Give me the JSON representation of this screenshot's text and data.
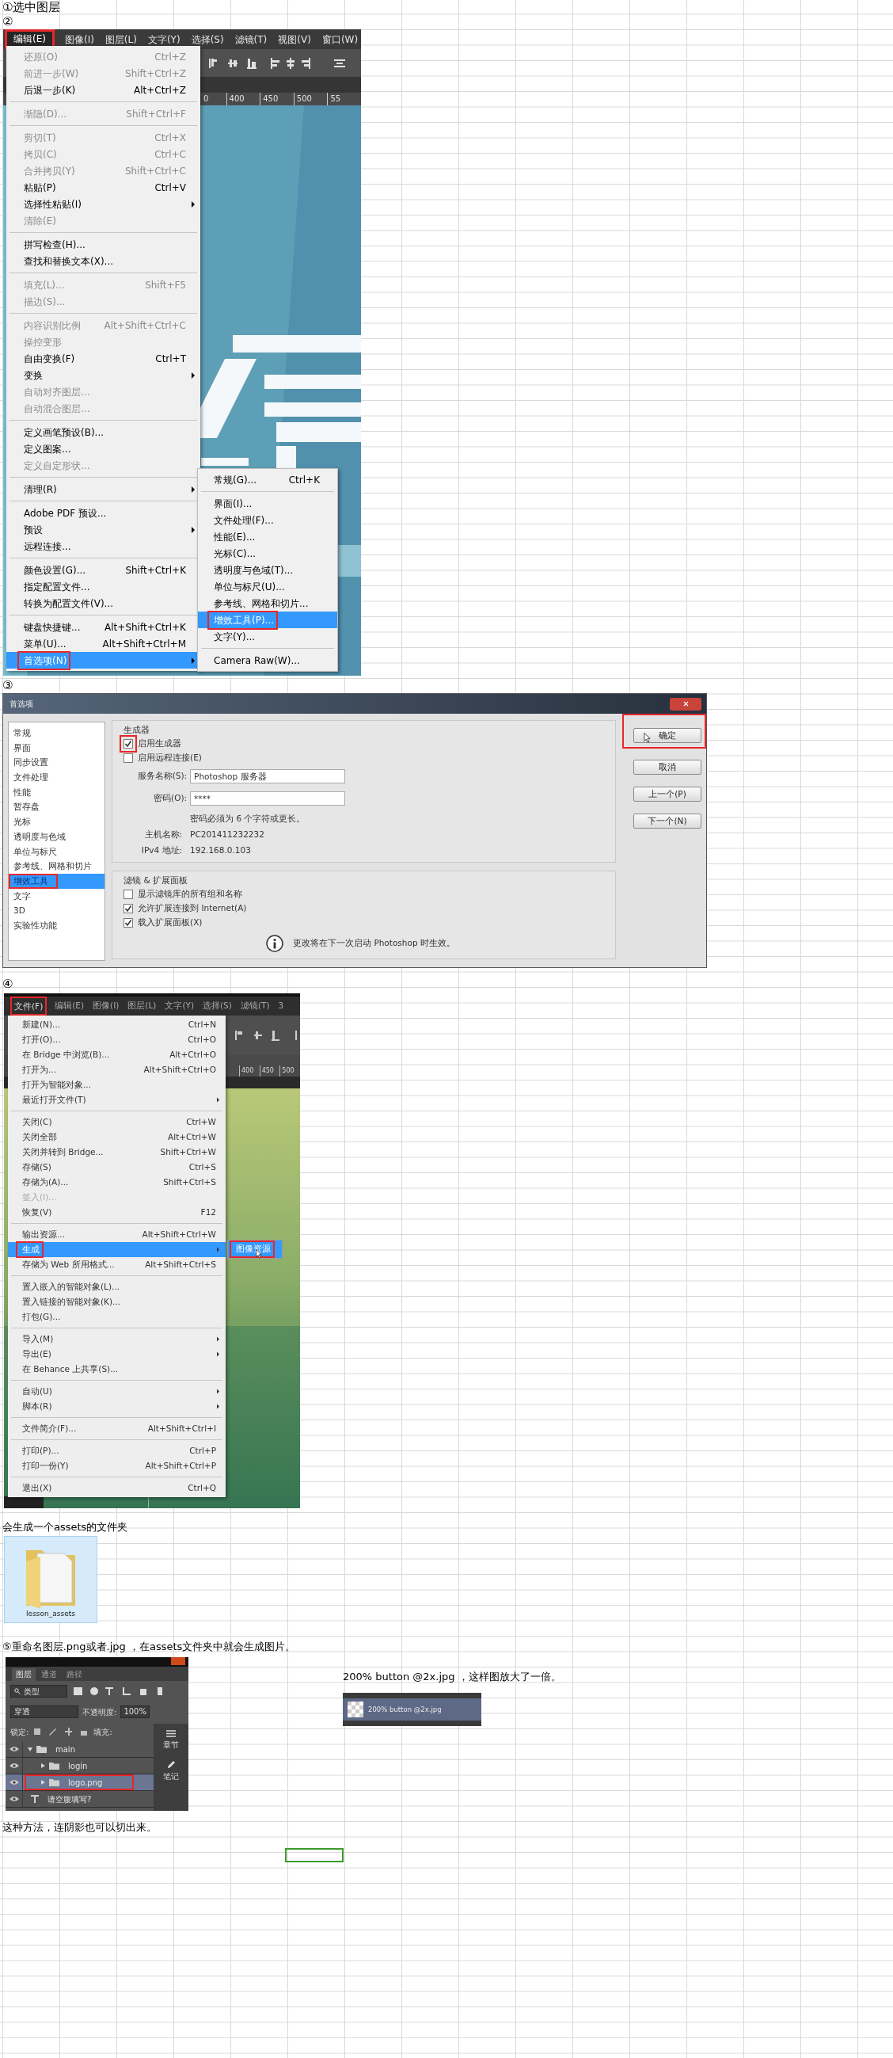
{
  "step1": "①选中图层",
  "step2": "②",
  "edit_screenshot": {
    "menubar": [
      {
        "label": "编辑(E)",
        "selected": true,
        "marked": true
      },
      {
        "label": "图像(I)",
        "selected": false,
        "marked": false
      },
      {
        "label": "图层(L)",
        "selected": false,
        "marked": false
      },
      {
        "label": "文字(Y)",
        "selected": false,
        "marked": false
      },
      {
        "label": "选择(S)",
        "selected": false,
        "marked": false
      },
      {
        "label": "滤镜(T)",
        "selected": false,
        "marked": false
      },
      {
        "label": "视图(V)",
        "selected": false,
        "marked": false
      },
      {
        "label": "窗口(W)",
        "selected": false,
        "marked": false
      }
    ],
    "ruler_labels": [
      "0",
      "400",
      "450",
      "500",
      "55"
    ],
    "menu": [
      [
        {
          "label": "还原(O)",
          "shortcut": "Ctrl+Z",
          "disabled": true,
          "has_submenu": false,
          "selected": false,
          "marked": false
        },
        {
          "label": "前进一步(W)",
          "shortcut": "Shift+Ctrl+Z",
          "disabled": true,
          "has_submenu": false,
          "selected": false,
          "marked": false
        },
        {
          "label": "后退一步(K)",
          "shortcut": "Alt+Ctrl+Z",
          "disabled": false,
          "has_submenu": false,
          "selected": false,
          "marked": false
        }
      ],
      [
        {
          "label": "渐隐(D)...",
          "shortcut": "Shift+Ctrl+F",
          "disabled": true,
          "has_submenu": false,
          "selected": false,
          "marked": false
        }
      ],
      [
        {
          "label": "剪切(T)",
          "shortcut": "Ctrl+X",
          "disabled": true,
          "has_submenu": false,
          "selected": false,
          "marked": false
        },
        {
          "label": "拷贝(C)",
          "shortcut": "Ctrl+C",
          "disabled": true,
          "has_submenu": false,
          "selected": false,
          "marked": false
        },
        {
          "label": "合并拷贝(Y)",
          "shortcut": "Shift+Ctrl+C",
          "disabled": true,
          "has_submenu": false,
          "selected": false,
          "marked": false
        },
        {
          "label": "粘贴(P)",
          "shortcut": "Ctrl+V",
          "disabled": false,
          "has_submenu": false,
          "selected": false,
          "marked": false
        },
        {
          "label": "选择性粘贴(I)",
          "disabled": false,
          "has_submenu": true,
          "selected": false,
          "marked": false
        },
        {
          "label": "清除(E)",
          "disabled": true,
          "has_submenu": false,
          "selected": false,
          "marked": false
        }
      ],
      [
        {
          "label": "拼写检查(H)...",
          "disabled": false,
          "has_submenu": false,
          "selected": false,
          "marked": false
        },
        {
          "label": "查找和替换文本(X)...",
          "disabled": false,
          "has_submenu": false,
          "selected": false,
          "marked": false
        }
      ],
      [
        {
          "label": "填充(L)...",
          "shortcut": "Shift+F5",
          "disabled": true,
          "has_submenu": false,
          "selected": false,
          "marked": false
        },
        {
          "label": "描边(S)...",
          "disabled": true,
          "has_submenu": false,
          "selected": false,
          "marked": false
        }
      ],
      [
        {
          "label": "内容识别比例",
          "shortcut": "Alt+Shift+Ctrl+C",
          "disabled": true,
          "has_submenu": false,
          "selected": false,
          "marked": false
        },
        {
          "label": "操控变形",
          "disabled": true,
          "has_submenu": false,
          "selected": false,
          "marked": false
        },
        {
          "label": "自由变换(F)",
          "shortcut": "Ctrl+T",
          "disabled": false,
          "has_submenu": false,
          "selected": false,
          "marked": false
        },
        {
          "label": "变换",
          "disabled": false,
          "has_submenu": true,
          "selected": false,
          "marked": false
        },
        {
          "label": "自动对齐图层...",
          "disabled": true,
          "has_submenu": false,
          "selected": false,
          "marked": false
        },
        {
          "label": "自动混合图层...",
          "disabled": true,
          "has_submenu": false,
          "selected": false,
          "marked": false
        }
      ],
      [
        {
          "label": "定义画笔预设(B)...",
          "disabled": false,
          "has_submenu": false,
          "selected": false,
          "marked": false
        },
        {
          "label": "定义图案...",
          "disabled": false,
          "has_submenu": false,
          "selected": false,
          "marked": false
        },
        {
          "label": "定义自定形状...",
          "disabled": true,
          "has_submenu": false,
          "selected": false,
          "marked": false
        }
      ],
      [
        {
          "label": "清理(R)",
          "disabled": false,
          "has_submenu": true,
          "selected": false,
          "marked": false
        }
      ],
      [
        {
          "label": "Adobe PDF 预设...",
          "disabled": false,
          "has_submenu": false,
          "selected": false,
          "marked": false
        },
        {
          "label": "预设",
          "disabled": false,
          "has_submenu": true,
          "selected": false,
          "marked": false
        },
        {
          "label": "远程连接...",
          "disabled": false,
          "has_submenu": false,
          "selected": false,
          "marked": false
        }
      ],
      [
        {
          "label": "颜色设置(G)...",
          "shortcut": "Shift+Ctrl+K",
          "disabled": false,
          "has_submenu": false,
          "selected": false,
          "marked": false
        },
        {
          "label": "指定配置文件...",
          "disabled": false,
          "has_submenu": false,
          "selected": false,
          "marked": false
        },
        {
          "label": "转换为配置文件(V)...",
          "disabled": false,
          "has_submenu": false,
          "selected": false,
          "marked": false
        }
      ],
      [
        {
          "label": "键盘快捷键...",
          "shortcut": "Alt+Shift+Ctrl+K",
          "disabled": false,
          "has_submenu": false,
          "selected": false,
          "marked": false
        },
        {
          "label": "菜单(U)...",
          "shortcut": "Alt+Shift+Ctrl+M",
          "disabled": false,
          "has_submenu": false,
          "selected": false,
          "marked": false
        },
        {
          "label": "首选项(N)",
          "disabled": false,
          "has_submenu": true,
          "selected": true,
          "marked": true
        }
      ]
    ],
    "submenu": [
      [
        {
          "label": "常规(G)...",
          "shortcut": "Ctrl+K",
          "disabled": false,
          "has_submenu": false,
          "selected": false,
          "marked": false
        }
      ],
      [
        {
          "label": "界面(I)...",
          "disabled": false,
          "has_submenu": false,
          "selected": false,
          "marked": false
        },
        {
          "label": "文件处理(F)...",
          "disabled": false,
          "has_submenu": false,
          "selected": false,
          "marked": false
        },
        {
          "label": "性能(E)...",
          "disabled": false,
          "has_submenu": false,
          "selected": false,
          "marked": false
        },
        {
          "label": "光标(C)...",
          "disabled": false,
          "has_submenu": false,
          "selected": false,
          "marked": false
        },
        {
          "label": "透明度与色域(T)...",
          "disabled": false,
          "has_submenu": false,
          "selected": false,
          "marked": false
        },
        {
          "label": "单位与标尺(U)...",
          "disabled": false,
          "has_submenu": false,
          "selected": false,
          "marked": false
        },
        {
          "label": "参考线、网格和切片...",
          "disabled": false,
          "has_submenu": false,
          "selected": false,
          "marked": false
        },
        {
          "label": "增效工具(P)...",
          "disabled": false,
          "has_submenu": false,
          "selected": true,
          "marked": true
        },
        {
          "label": "文字(Y)...",
          "disabled": false,
          "has_submenu": false,
          "selected": false,
          "marked": false
        }
      ],
      [
        {
          "label": "Camera Raw(W)...",
          "disabled": false,
          "has_submenu": false,
          "selected": false,
          "marked": false
        }
      ]
    ]
  },
  "step3": "③",
  "preferences_dialog": {
    "title": "首选项",
    "categories": [
      {
        "label": "常规",
        "selected": false,
        "marked": false
      },
      {
        "label": "界面",
        "selected": false,
        "marked": false
      },
      {
        "label": "同步设置",
        "selected": false,
        "marked": false
      },
      {
        "label": "文件处理",
        "selected": false,
        "marked": false
      },
      {
        "label": "性能",
        "selected": false,
        "marked": false
      },
      {
        "label": "暂存盘",
        "selected": false,
        "marked": false
      },
      {
        "label": "光标",
        "selected": false,
        "marked": false
      },
      {
        "label": "透明度与色域",
        "selected": false,
        "marked": false
      },
      {
        "label": "单位与标尺",
        "selected": false,
        "marked": false
      },
      {
        "label": "参考线、网格和切片",
        "selected": false,
        "marked": false
      },
      {
        "label": "增效工具",
        "selected": true,
        "marked": true
      },
      {
        "label": "文字",
        "selected": false,
        "marked": false
      },
      {
        "label": "3D",
        "selected": false,
        "marked": false
      },
      {
        "label": "实验性功能",
        "selected": false,
        "marked": false
      }
    ],
    "generator": {
      "title": "生成器",
      "options": [
        {
          "label": "启用生成器",
          "checked": true,
          "marked": true
        },
        {
          "label": "启用远程连接(E)",
          "checked": false,
          "marked": false
        }
      ],
      "fields": [
        {
          "label": "服务名称(S):",
          "value": "Photoshop 服务器"
        },
        {
          "label": "密码(O):",
          "value": "****"
        }
      ],
      "hint": "密码必须为 6 个字符或更长。",
      "info": [
        {
          "label": "主机名称:",
          "value": "PC201411232232"
        },
        {
          "label": "IPv4 地址:",
          "value": "192.168.0.103"
        }
      ]
    },
    "extensions": {
      "title": "滤镜 & 扩展面板",
      "options": [
        {
          "label": "显示滤镜库的所有组和名称",
          "checked": false,
          "marked": false
        },
        {
          "label": "允许扩展连接到 Internet(A)",
          "checked": true,
          "marked": false
        },
        {
          "label": "载入扩展面板(X)",
          "checked": true,
          "marked": false
        }
      ],
      "notice": "更改将在下一次启动 Photoshop 时生效。"
    },
    "buttons": [
      {
        "label": "确定",
        "marked": true
      },
      {
        "label": "取消",
        "marked": false
      },
      {
        "label": "上一个(P)",
        "marked": false
      },
      {
        "label": "下一个(N)",
        "marked": false
      }
    ]
  },
  "step4": "④",
  "file_screenshot": {
    "menubar": [
      {
        "label": "文件(F)",
        "selected": true,
        "marked": true
      },
      {
        "label": "编辑(E)",
        "selected": false,
        "marked": false
      },
      {
        "label": "图像(I)",
        "selected": false,
        "marked": false
      },
      {
        "label": "图层(L)",
        "selected": false,
        "marked": false
      },
      {
        "label": "文字(Y)",
        "selected": false,
        "marked": false
      },
      {
        "label": "选择(S)",
        "selected": false,
        "marked": false
      },
      {
        "label": "滤镜(T)",
        "selected": false,
        "marked": false
      },
      {
        "label": "3",
        "selected": false,
        "marked": false
      }
    ],
    "ruler_labels": [
      "400",
      "450",
      "500"
    ],
    "menu": [
      [
        {
          "label": "新建(N)...",
          "shortcut": "Ctrl+N",
          "disabled": false,
          "has_submenu": false,
          "selected": false,
          "marked": false
        },
        {
          "label": "打开(O)...",
          "shortcut": "Ctrl+O",
          "disabled": false,
          "has_submenu": false,
          "selected": false,
          "marked": false
        },
        {
          "label": "在 Bridge 中浏览(B)...",
          "shortcut": "Alt+Ctrl+O",
          "disabled": false,
          "has_submenu": false,
          "selected": false,
          "marked": false
        },
        {
          "label": "打开为...",
          "shortcut": "Alt+Shift+Ctrl+O",
          "disabled": false,
          "has_submenu": false,
          "selected": false,
          "marked": false
        },
        {
          "label": "打开为智能对象...",
          "disabled": false,
          "has_submenu": false,
          "selected": false,
          "marked": false
        },
        {
          "label": "最近打开文件(T)",
          "disabled": false,
          "has_submenu": true,
          "selected": false,
          "marked": false
        }
      ],
      [
        {
          "label": "关闭(C)",
          "shortcut": "Ctrl+W",
          "disabled": false,
          "has_submenu": false,
          "selected": false,
          "marked": false
        },
        {
          "label": "关闭全部",
          "shortcut": "Alt+Ctrl+W",
          "disabled": false,
          "has_submenu": false,
          "selected": false,
          "marked": false
        },
        {
          "label": "关闭并转到 Bridge...",
          "shortcut": "Shift+Ctrl+W",
          "disabled": false,
          "has_submenu": false,
          "selected": false,
          "marked": false
        },
        {
          "label": "存储(S)",
          "shortcut": "Ctrl+S",
          "disabled": false,
          "has_submenu": false,
          "selected": false,
          "marked": false
        },
        {
          "label": "存储为(A)...",
          "shortcut": "Shift+Ctrl+S",
          "disabled": false,
          "has_submenu": false,
          "selected": false,
          "marked": false
        },
        {
          "label": "签入(I)...",
          "disabled": true,
          "has_submenu": false,
          "selected": false,
          "marked": false
        },
        {
          "label": "恢复(V)",
          "shortcut": "F12",
          "disabled": false,
          "has_submenu": false,
          "selected": false,
          "marked": false
        }
      ],
      [
        {
          "label": "输出资源...",
          "shortcut": "Alt+Shift+Ctrl+W",
          "disabled": false,
          "has_submenu": false,
          "selected": false,
          "marked": false
        },
        {
          "label": "生成",
          "disabled": false,
          "has_submenu": true,
          "selected": true,
          "marked": true
        },
        {
          "label": "存储为 Web 所用格式...",
          "shortcut": "Alt+Shift+Ctrl+S",
          "disabled": false,
          "has_submenu": false,
          "selected": false,
          "marked": false
        }
      ],
      [
        {
          "label": "置入嵌入的智能对象(L)...",
          "disabled": false,
          "has_submenu": false,
          "selected": false,
          "marked": false
        },
        {
          "label": "置入链接的智能对象(K)...",
          "disabled": false,
          "has_submenu": false,
          "selected": false,
          "marked": false
        },
        {
          "label": "打包(G)...",
          "disabled": false,
          "has_submenu": false,
          "selected": false,
          "marked": false
        }
      ],
      [
        {
          "label": "导入(M)",
          "disabled": false,
          "has_submenu": true,
          "selected": false,
          "marked": false
        },
        {
          "label": "导出(E)",
          "disabled": false,
          "has_submenu": true,
          "selected": false,
          "marked": false
        },
        {
          "label": "在 Behance 上共享(S)...",
          "disabled": false,
          "has_submenu": false,
          "selected": false,
          "marked": false
        }
      ],
      [
        {
          "label": "自动(U)",
          "disabled": false,
          "has_submenu": true,
          "selected": false,
          "marked": false
        },
        {
          "label": "脚本(R)",
          "disabled": false,
          "has_submenu": true,
          "selected": false,
          "marked": false
        }
      ],
      [
        {
          "label": "文件简介(F)...",
          "shortcut": "Alt+Shift+Ctrl+I",
          "disabled": false,
          "has_submenu": false,
          "selected": false,
          "marked": false
        }
      ],
      [
        {
          "label": "打印(P)...",
          "shortcut": "Ctrl+P",
          "disabled": false,
          "has_submenu": false,
          "selected": false,
          "marked": false
        },
        {
          "label": "打印一份(Y)",
          "shortcut": "Alt+Shift+Ctrl+P",
          "disabled": false,
          "has_submenu": false,
          "selected": false,
          "marked": false
        }
      ],
      [
        {
          "label": "退出(X)",
          "shortcut": "Ctrl+Q",
          "disabled": false,
          "has_submenu": false,
          "selected": false,
          "marked": false
        }
      ]
    ],
    "submenu": [
      [
        {
          "label": "图像资源",
          "disabled": false,
          "has_submenu": false,
          "selected": true,
          "marked": true
        }
      ]
    ]
  },
  "assets_caption": "会生成一个assets的文件夹",
  "folder": {
    "label": "lesson_assets",
    "selected": true
  },
  "step5": "⑤重命名图层.png或者.jpg ，在assets文件夹中就会生成图片。",
  "layers_screenshot": {
    "tabs": [
      {
        "label": "图层",
        "selected": true
      },
      {
        "label": "通道",
        "selected": false
      },
      {
        "label": "路径",
        "selected": false
      }
    ],
    "filter": "类型",
    "blend_mode": "穿透",
    "opacity_label": "不透明度:",
    "opacity": "100%",
    "lock_label": "锁定:",
    "fill_label": "填充:",
    "layers": [
      {
        "name": "main",
        "kind": "group",
        "expanded": true,
        "selected": false,
        "marked": false,
        "children": [
          {
            "name": "login",
            "kind": "group",
            "expanded": false,
            "selected": false,
            "marked": false
          },
          {
            "name": "logo.png",
            "kind": "group",
            "expanded": false,
            "selected": true,
            "marked": true
          }
        ]
      },
      {
        "name": "请空腹填写?",
        "kind": "text",
        "selected": false,
        "marked": false
      }
    ],
    "side_panel": [
      {
        "label": "章节",
        "kind": "menu"
      },
      {
        "label": "笔记",
        "kind": "pencil"
      }
    ]
  },
  "retina_note": "200% button @2x.jpg ，这样图放大了一倍。",
  "retina_layer": {
    "name": "200% button @2x.jpg",
    "selected": true
  },
  "closing": "这种方法，连阴影也可以切出来。",
  "active_cell": {
    "selected": true
  }
}
